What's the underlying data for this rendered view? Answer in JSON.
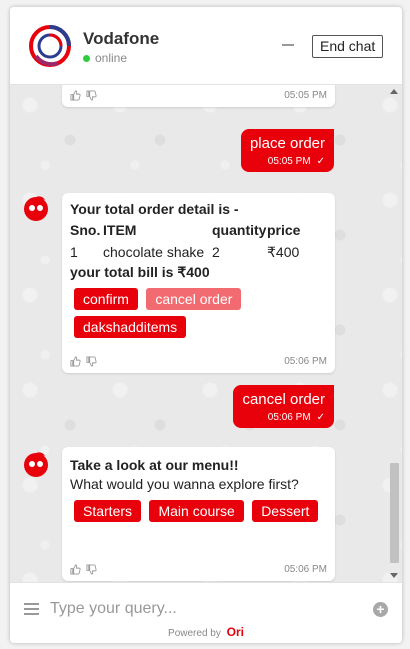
{
  "header": {
    "title": "Vodafone",
    "status": "online",
    "end_chat_label": "End chat"
  },
  "messages": {
    "top_card": {
      "time": "05:05 PM"
    },
    "user_1": {
      "text": "place order",
      "time": "05:05 PM"
    },
    "order_card": {
      "title": "Your total order detail is -",
      "table_headers": [
        "Sno.",
        "ITEM",
        "quantity",
        "price"
      ],
      "rows": [
        {
          "sno": "1",
          "item": "chocolate shake",
          "quantity": "2",
          "price": "₹400"
        }
      ],
      "total": "your total bill is ₹400",
      "buttons": [
        "confirm",
        "cancel order",
        "dakshadditems"
      ],
      "time": "05:06 PM"
    },
    "user_2": {
      "text": "cancel order",
      "time": "05:06 PM"
    },
    "menu_card": {
      "title": "Take a look at our menu!!",
      "subtitle": "What would you wanna explore first?",
      "buttons": [
        "Starters",
        "Main course",
        "Dessert"
      ],
      "time": "05:06 PM"
    }
  },
  "composer": {
    "placeholder": "Type your query...",
    "powered_by": "Powered by",
    "brand": "Ori"
  },
  "colors": {
    "accent": "#e8000b",
    "accent_muted": "#f26b70",
    "online": "#2ecc40"
  }
}
